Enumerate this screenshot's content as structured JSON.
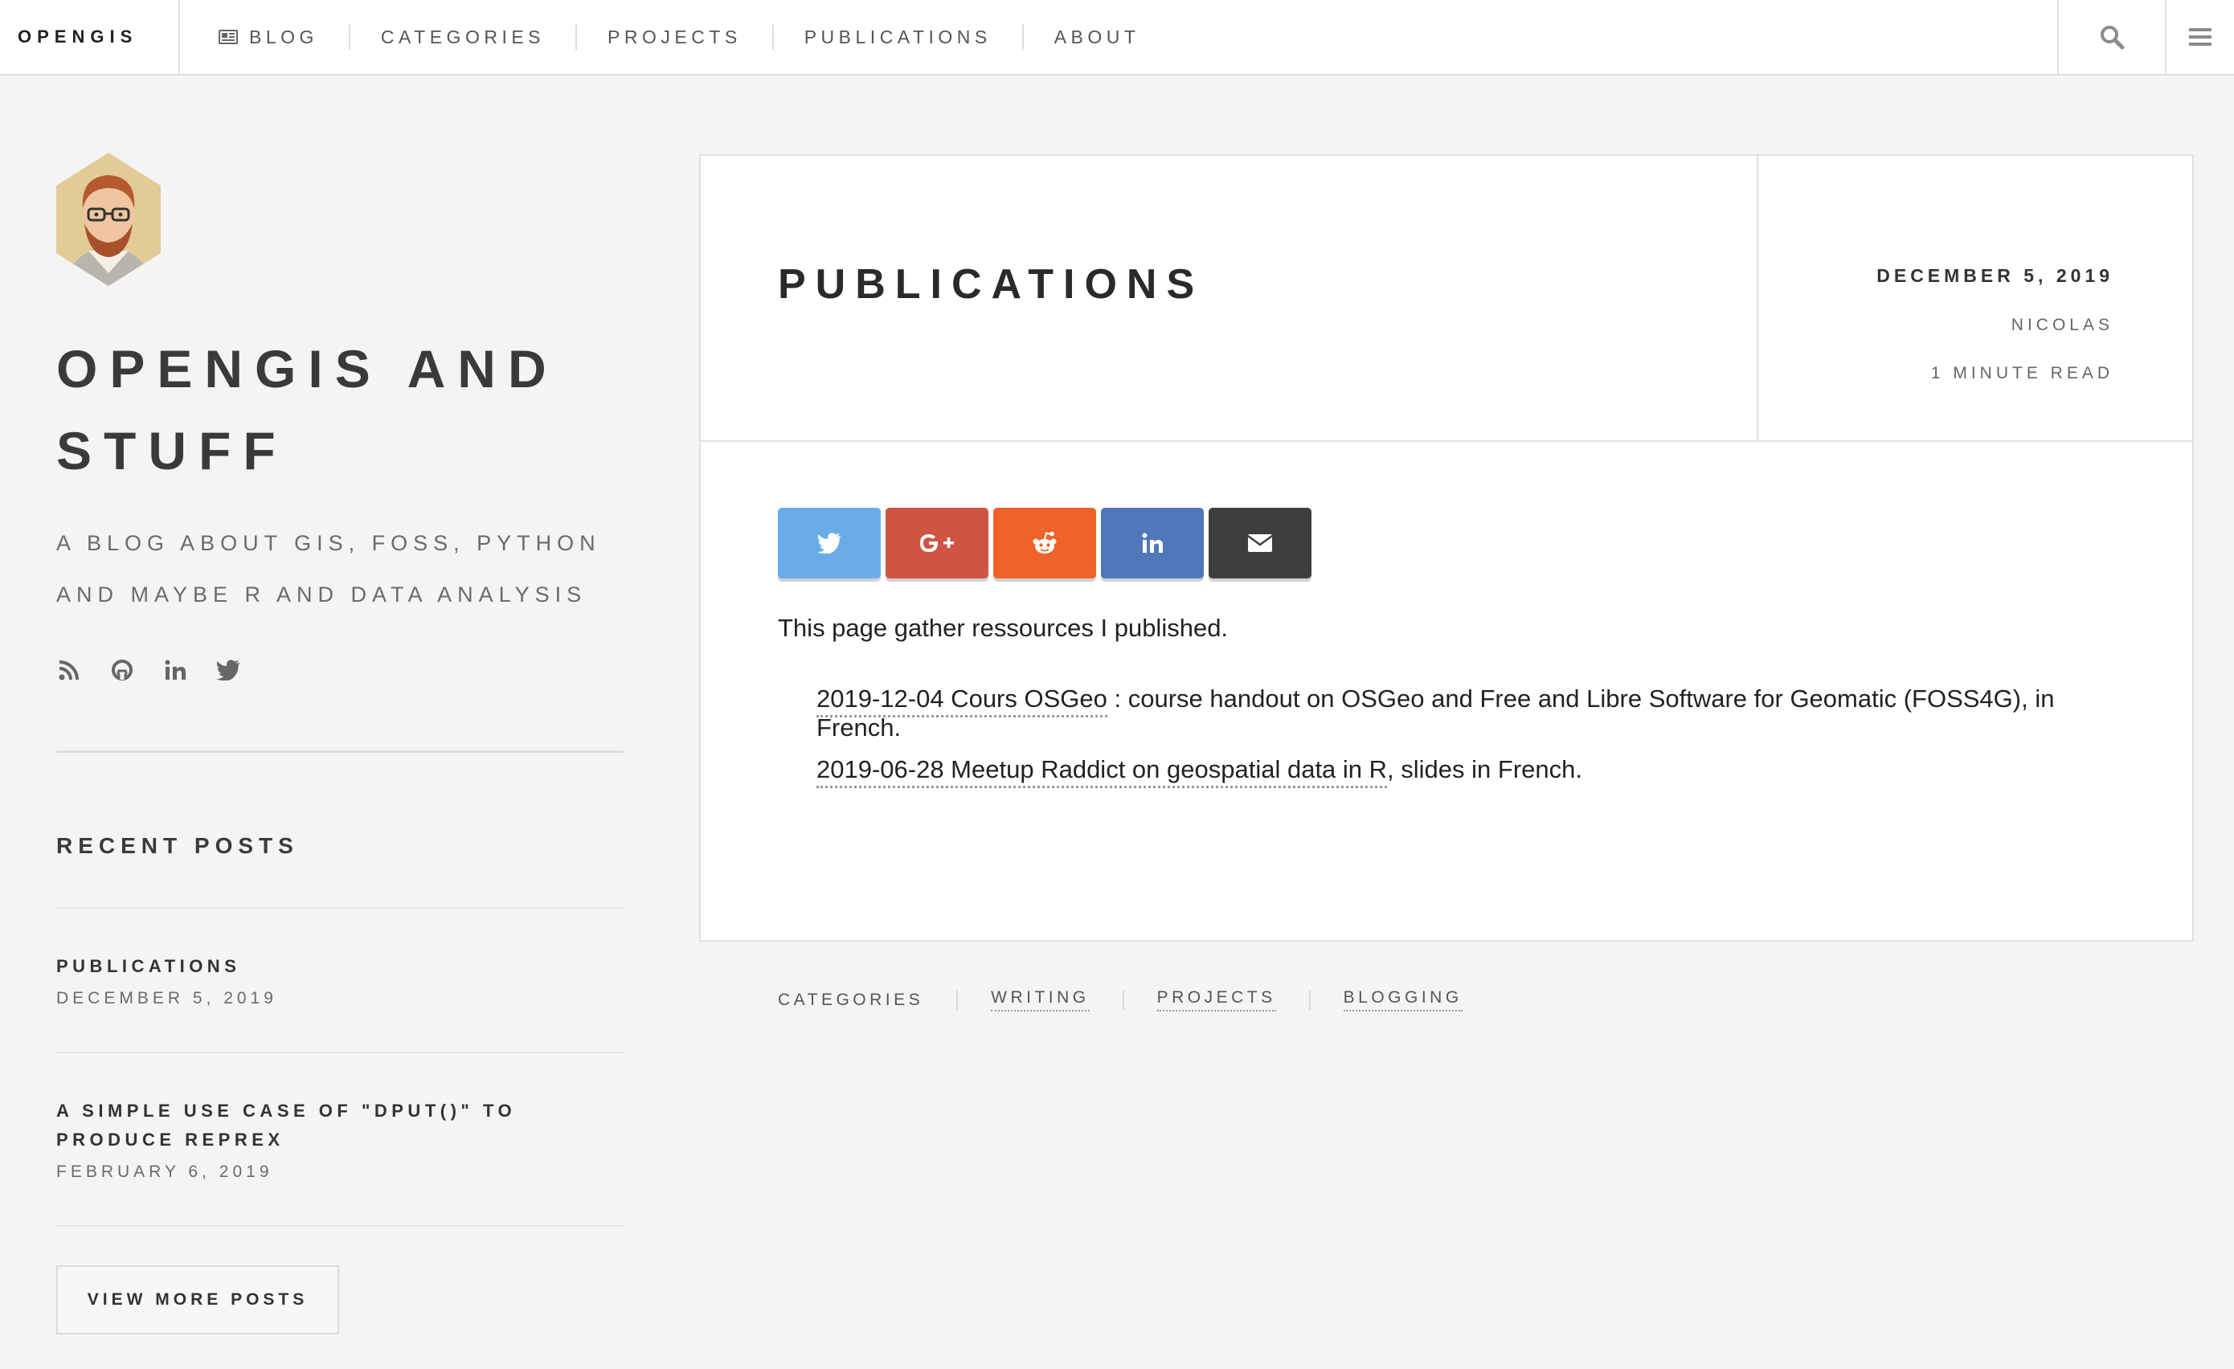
{
  "nav": {
    "brand": "OPENGIS",
    "links": [
      {
        "label": "BLOG",
        "icon": "newspaper-icon"
      },
      {
        "label": "CATEGORIES"
      },
      {
        "label": "PROJECTS"
      },
      {
        "label": "PUBLICATIONS"
      },
      {
        "label": "ABOUT"
      }
    ],
    "search_icon": "search-icon",
    "menu_icon": "hamburger-menu-icon"
  },
  "sidebar": {
    "title": "OPENGIS AND STUFF",
    "description": "A BLOG ABOUT GIS, FOSS, PYTHON AND MAYBE R AND DATA ANALYSIS",
    "social": [
      "rss-icon",
      "github-icon",
      "linkedin-icon",
      "twitter-icon"
    ],
    "recent_heading": "RECENT POSTS",
    "recent_posts": [
      {
        "title": "PUBLICATIONS",
        "date": "DECEMBER 5, 2019"
      },
      {
        "title": "A SIMPLE USE CASE OF \"DPUT()\" TO PRODUCE REPREX",
        "date": "FEBRUARY 6, 2019"
      }
    ],
    "more_button": "VIEW MORE POSTS"
  },
  "post": {
    "title": "PUBLICATIONS",
    "date": "DECEMBER 5, 2019",
    "author": "NICOLAS",
    "read_time": "1 MINUTE READ",
    "share": [
      {
        "name": "twitter",
        "color": "#6aace8"
      },
      {
        "name": "google-plus",
        "color": "#cf5444"
      },
      {
        "name": "reddit",
        "color": "#ef6229"
      },
      {
        "name": "linkedin",
        "color": "#5077b8"
      },
      {
        "name": "email",
        "color": "#3e3e3e"
      }
    ],
    "intro": "This page gather ressources I published.",
    "publications": [
      {
        "link": "2019-12-04 Cours OSGeo",
        "text": " : course handout on OSGeo and Free and Libre Software for Geomatic (FOSS4G), in French."
      },
      {
        "link": "2019-06-28 Meetup Raddict on geospatial data in R",
        "text": ", slides in French."
      }
    ],
    "tags_label": "CATEGORIES",
    "tags": [
      "WRITING",
      "PROJECTS",
      "BLOGGING"
    ]
  }
}
